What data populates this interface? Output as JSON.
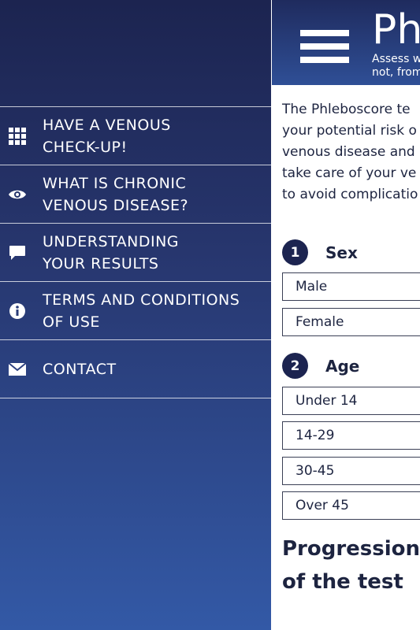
{
  "sidebar": {
    "items": [
      {
        "label": "HAVE A VENOUS\nCHECK-UP!",
        "icon": "grid-icon"
      },
      {
        "label": "WHAT IS CHRONIC\nVENOUS DISEASE?",
        "icon": "eye-icon"
      },
      {
        "label": "UNDERSTANDING\nYOUR RESULTS",
        "icon": "chat-bubble-icon"
      },
      {
        "label": "TERMS AND CONDITIONS\nOF USE",
        "icon": "info-icon"
      },
      {
        "label": "CONTACT",
        "icon": "envelope-icon"
      }
    ]
  },
  "header": {
    "brand": "Phl",
    "tagline": "Assess w\nnot, from"
  },
  "intro": {
    "text": "The Phleboscore te\nyour potential risk o\nvenous disease and\ntake care of your ve\nto avoid complicatio"
  },
  "questions": [
    {
      "number": "1",
      "title": "Sex",
      "options": [
        "Male",
        "Female"
      ]
    },
    {
      "number": "2",
      "title": "Age",
      "options": [
        "Under 14",
        "14-29",
        "30-45",
        "Over 45"
      ]
    }
  ],
  "progress": {
    "title": "Progression\nof the test"
  },
  "colors": {
    "sidebar_top": "#1c2450",
    "sidebar_bottom": "#3359a6",
    "text_dark": "#1d2440"
  }
}
